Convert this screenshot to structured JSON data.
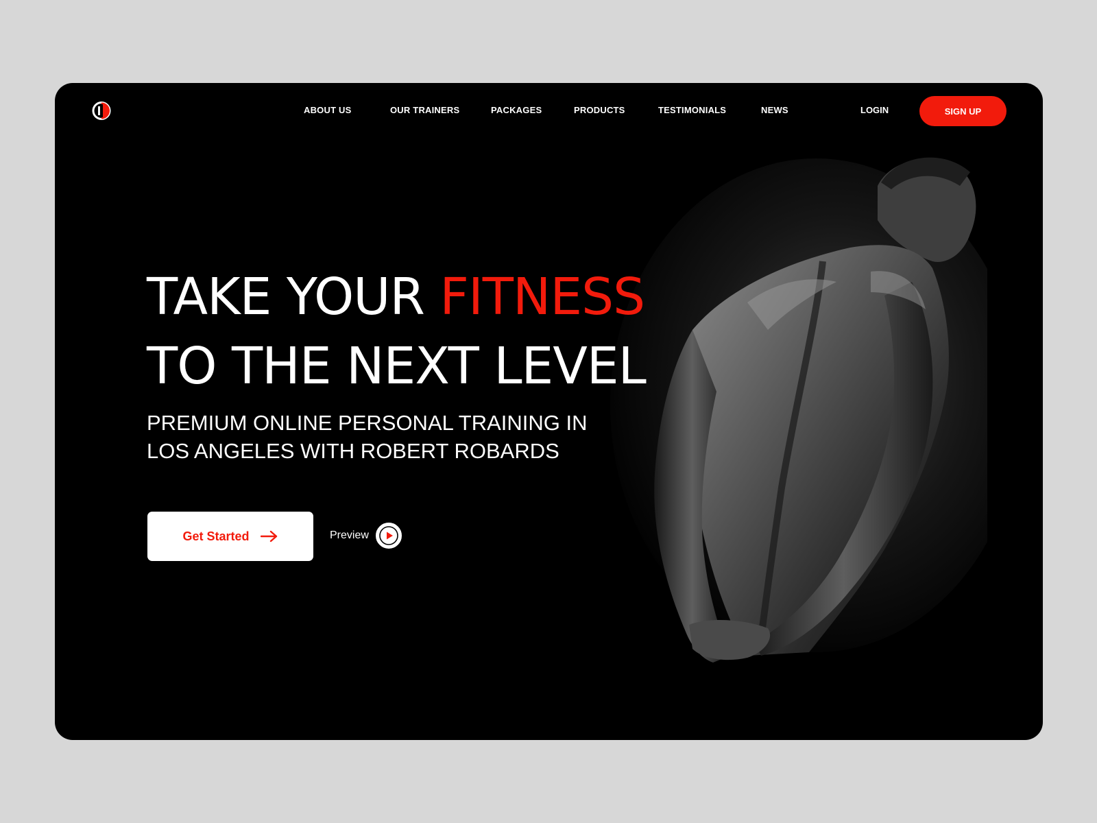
{
  "nav": {
    "links": [
      {
        "label": "ABOUT US"
      },
      {
        "label": "OUR TRAINERS"
      },
      {
        "label": "PACKAGES"
      },
      {
        "label": "PRODUCTS"
      },
      {
        "label": "TESTIMONIALS"
      },
      {
        "label": "NEWS"
      }
    ],
    "login_label": "LOGIN",
    "signup_label": "SIGN UP"
  },
  "hero": {
    "headline_line1_part1": "TAKE YOUR ",
    "headline_line1_accent": "FITNESS",
    "headline_line2": "TO THE NEXT LEVEL",
    "subhead_line1": "PREMIUM ONLINE PERSONAL TRAINING IN",
    "subhead_line2": "LOS ANGELES WITH ROBERT ROBARDS",
    "cta_label": "Get Started",
    "preview_label": "Preview"
  },
  "icons": {
    "logo": "brand-logo-icon",
    "cta_arrow": "arrow-right-icon",
    "play": "play-icon"
  },
  "colors": {
    "background": "#d7d7d7",
    "frame": "#000000",
    "accent": "#f21b0c",
    "text": "#ffffff"
  }
}
